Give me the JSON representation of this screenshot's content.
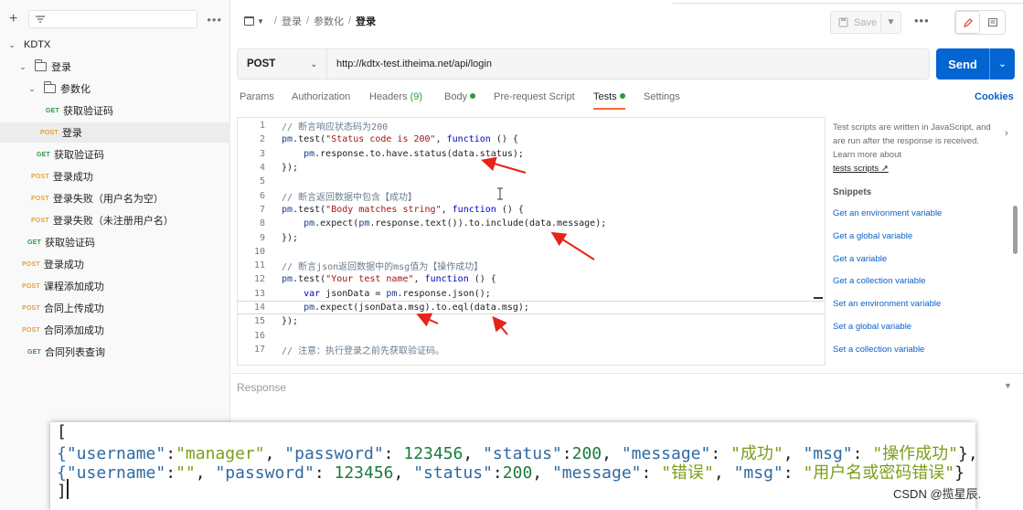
{
  "sidebar": {
    "tree": [
      {
        "kind": "collection",
        "label": "KDTX",
        "expanded": true
      },
      {
        "kind": "folder",
        "label": "登录",
        "expanded": true
      },
      {
        "kind": "folder",
        "label": "参数化",
        "expanded": true
      },
      {
        "kind": "request",
        "method": "GET",
        "label": "获取验证码"
      },
      {
        "kind": "request",
        "method": "POST",
        "label": "登录",
        "selected": true
      },
      {
        "kind": "request",
        "method": "GET",
        "label": "获取验证码"
      },
      {
        "kind": "request",
        "method": "POST",
        "label": "登录成功"
      },
      {
        "kind": "request",
        "method": "POST",
        "label": "登录失败（用户名为空）"
      },
      {
        "kind": "request",
        "method": "POST",
        "label": "登录失败（未注册用户名）"
      },
      {
        "kind": "request",
        "method": "GET",
        "label": "获取验证码"
      },
      {
        "kind": "request",
        "method": "POST",
        "label": "登录成功"
      },
      {
        "kind": "request",
        "method": "POST",
        "label": "课程添加成功"
      },
      {
        "kind": "request",
        "method": "POST",
        "label": "合同上传成功"
      },
      {
        "kind": "request",
        "method": "POST",
        "label": "合同添加成功"
      },
      {
        "kind": "request",
        "method": "GET",
        "label": "合同列表查询"
      }
    ]
  },
  "breadcrumb": {
    "items": [
      "登录",
      "参数化"
    ],
    "current": "登录"
  },
  "toolbar": {
    "save_label": "Save"
  },
  "request": {
    "method": "POST",
    "url": "http://kdtx-test.itheima.net/api/login",
    "send_label": "Send"
  },
  "tabs": {
    "params": "Params",
    "authorization": "Authorization",
    "headers": "Headers",
    "headers_count": "(9)",
    "body": "Body",
    "prerequest": "Pre-request Script",
    "tests": "Tests",
    "settings": "Settings",
    "cookies": "Cookies"
  },
  "editor": {
    "lines": [
      "// 断言响应状态码为200",
      "pm.test(\"Status code is 200\", function () {",
      "    pm.response.to.have.status(data.status);",
      "});",
      "",
      "// 断言返回数据中包含【成功】",
      "pm.test(\"Body matches string\", function () {",
      "    pm.expect(pm.response.text()).to.include(data.message);",
      "});",
      "",
      "// 断言json返回数据中的msg值为【操作成功】",
      "pm.test(\"Your test name\", function () {",
      "    var jsonData = pm.response.json();",
      "    pm.expect(jsonData.msg).to.eql(data.msg);",
      "});",
      "",
      "// 注意：执行登录之前先获取验证码。"
    ],
    "active_line": 14
  },
  "side_panel": {
    "info_text": "Test scripts are written in JavaScript, and are run after the response is received. Learn more about",
    "info_link": "tests scripts ↗",
    "snippets_title": "Snippets",
    "snippets": [
      "Get an environment variable",
      "Get a global variable",
      "Get a variable",
      "Get a collection variable",
      "Set an environment variable",
      "Set a global variable",
      "Set a collection variable"
    ]
  },
  "response": {
    "label": "Response"
  },
  "data_file_overlay": {
    "lines": [
      "[",
      "{\"username\":\"manager\", \"password\": 123456, \"status\":200, \"message\": \"成功\", \"msg\": \"操作成功\"},",
      "{\"username\":\"\", \"password\": 123456, \"status\":200, \"message\": \"错误\", \"msg\": \"用户名或密码错误\"}",
      "]"
    ]
  },
  "watermark": "CSDN @揽星辰.",
  "colors": {
    "accent": "#0265d2",
    "tab_underline": "#f26b3a",
    "get": "#2a9d3c",
    "post": "#e3a336",
    "annotation_arrows": "#e8221a"
  }
}
